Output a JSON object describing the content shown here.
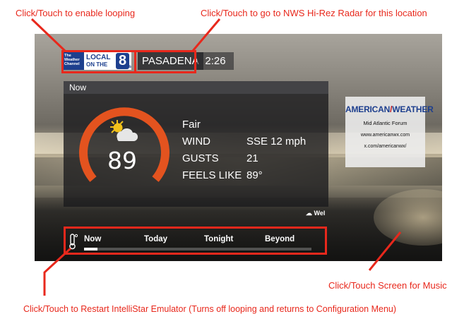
{
  "annotations": {
    "loop": "Click/Touch to enable looping",
    "radar": "Click/Touch to go to NWS Hi-Rez Radar for this location",
    "music": "Click/Touch Screen for Music",
    "restart": "Click/Touch to Restart IntelliStar Emulator (Turns off looping and returns to Configuration Menu)"
  },
  "header": {
    "logo": {
      "brand_line1": "The",
      "brand_line2": "Weather",
      "brand_line3": "Channel",
      "local": "LOCAL",
      "on_the": "ON THE",
      "eight": "8",
      "s": "s"
    },
    "city": "PASADENA",
    "time": "2:26"
  },
  "now_panel": {
    "title": "Now",
    "temperature": "89",
    "condition": "Fair",
    "icon": "partly-sunny-icon",
    "rows": {
      "wind_label": "WIND",
      "wind_value": "SSE 12 mph",
      "gusts_label": "GUSTS",
      "gusts_value": "21",
      "feels_label": "FEELS LIKE",
      "feels_value": "89°"
    },
    "ticker": "Wel"
  },
  "sponsor": {
    "logo_left": "AMERICAN",
    "logo_right": "WEATHER",
    "forum": "Mid Atlantic Forum",
    "site": "www.americanwx.com",
    "social": "x.com/americanwx/"
  },
  "nav": {
    "tabs": [
      "Now",
      "Today",
      "Tonight",
      "Beyond"
    ],
    "progress": 0.06
  },
  "colors": {
    "annotation_red": "#e8281c",
    "gauge_orange": "#e3531f",
    "brand_blue": "#1d3f8e"
  }
}
